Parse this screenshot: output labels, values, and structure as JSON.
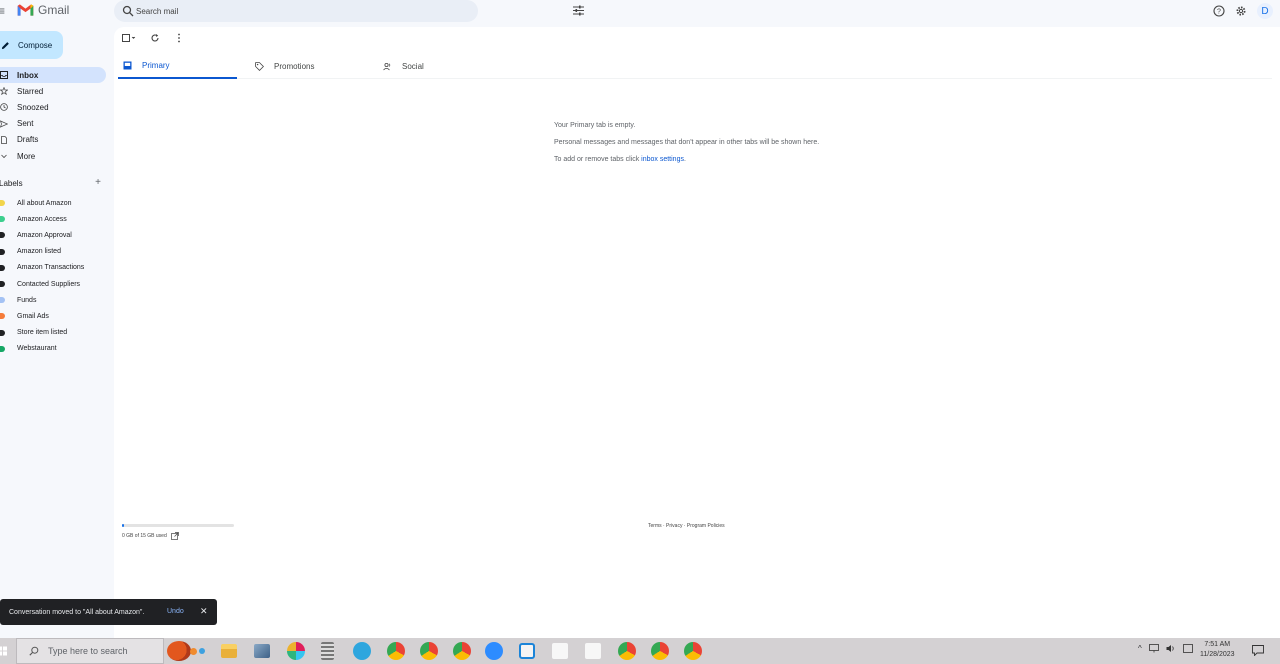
{
  "app": {
    "name": "Gmail"
  },
  "search": {
    "placeholder": "Search mail"
  },
  "account": {
    "avatar_letter": "D"
  },
  "compose": {
    "label": "Compose"
  },
  "nav": [
    {
      "label": "Inbox",
      "icon": "inbox-icon",
      "active": true
    },
    {
      "label": "Starred",
      "icon": "star-icon"
    },
    {
      "label": "Snoozed",
      "icon": "clock-icon"
    },
    {
      "label": "Sent",
      "icon": "send-icon"
    },
    {
      "label": "Drafts",
      "icon": "draft-icon"
    },
    {
      "label": "More",
      "icon": "chevron-down-icon"
    }
  ],
  "labels_section": {
    "title": "Labels",
    "add": "+"
  },
  "labels": [
    {
      "label": "All about Amazon",
      "color": "#f2d54b"
    },
    {
      "label": "Amazon Access",
      "color": "#3ccf8e"
    },
    {
      "label": "Amazon Approval",
      "color": "#202124"
    },
    {
      "label": "Amazon listed",
      "color": "#202124"
    },
    {
      "label": "Amazon Transactions",
      "color": "#202124"
    },
    {
      "label": "Contacted Suppliers",
      "color": "#202124"
    },
    {
      "label": "Funds",
      "color": "#a4c2f4"
    },
    {
      "label": "Gmail Ads",
      "color": "#f57c3a"
    },
    {
      "label": "Store item listed",
      "color": "#202124"
    },
    {
      "label": "Webstaurant",
      "color": "#16a765"
    }
  ],
  "tabs": [
    {
      "label": "Primary",
      "icon": "inbox-tab-icon",
      "active": true
    },
    {
      "label": "Promotions",
      "icon": "tag-icon"
    },
    {
      "label": "Social",
      "icon": "people-icon"
    }
  ],
  "empty_state": {
    "line1": "Your Primary tab is empty.",
    "line2": "Personal messages and messages that don't appear in other tabs will be shown here.",
    "line3_prefix": "To add or remove tabs click ",
    "line3_link": "inbox settings",
    "line3_suffix": "."
  },
  "storage": {
    "text": "0 GB of 15 GB used",
    "fraction_used": 0.0
  },
  "footer": {
    "links": "Terms · Privacy · Program Policies"
  },
  "toast": {
    "message": "Conversation moved to \"All about Amazon\".",
    "undo": "Undo",
    "close": "✕"
  },
  "taskbar": {
    "search_placeholder": "Type here to search",
    "time": "7:51 AM",
    "date": "11/28/2023"
  }
}
